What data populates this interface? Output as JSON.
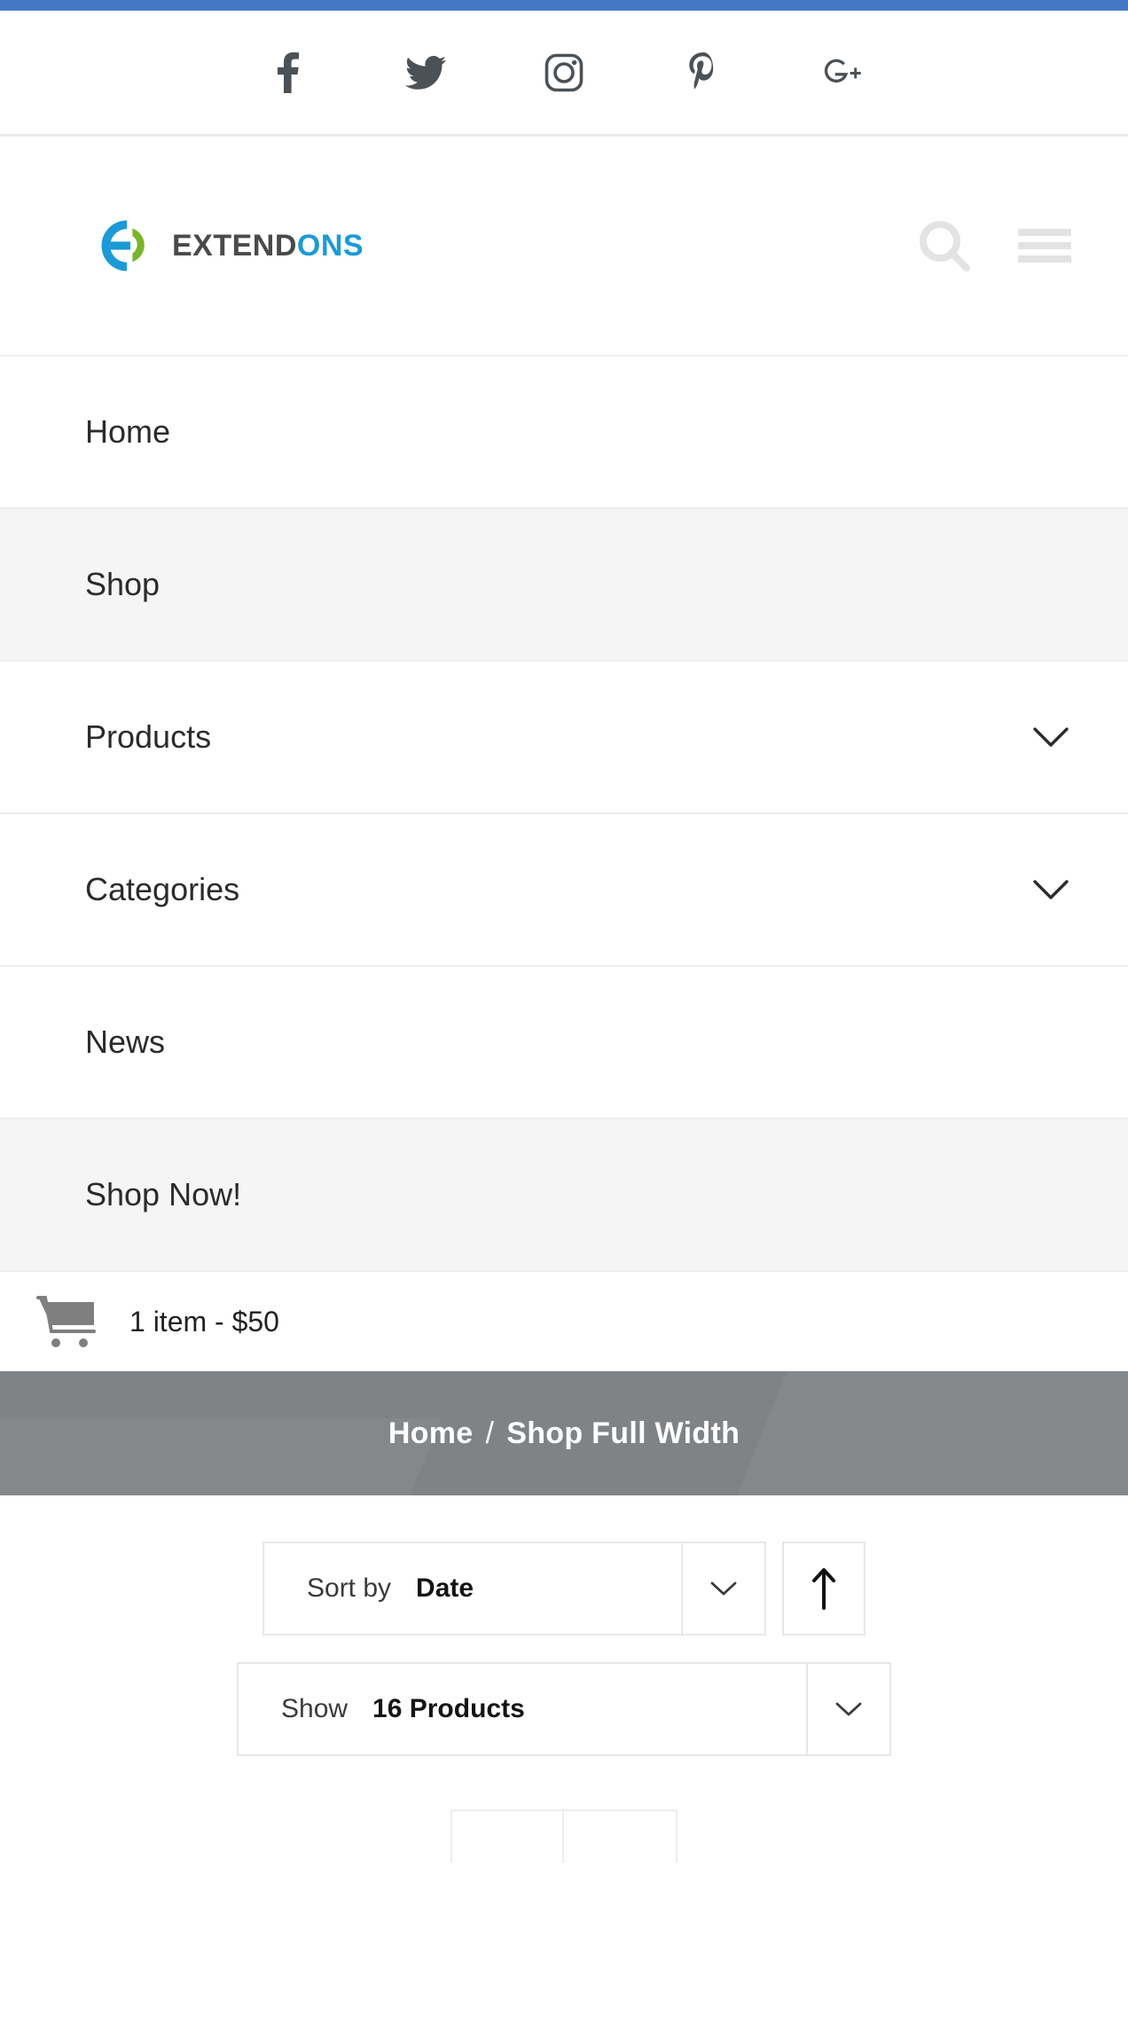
{
  "theme": {
    "accent_blue": "#4578c4",
    "brand_dark": "#4a4a4a",
    "brand_blue": "#1c9ad6",
    "brand_green": "#7ab52b",
    "banner_gray": "#808385",
    "row_active_gray": "#f5f5f5",
    "icon_gray": "#4c5156",
    "border_gray": "#e8e8e8"
  },
  "topbar": {
    "social": [
      {
        "name": "facebook-icon",
        "label": "Facebook"
      },
      {
        "name": "twitter-icon",
        "label": "Twitter"
      },
      {
        "name": "instagram-icon",
        "label": "Instagram"
      },
      {
        "name": "pinterest-icon",
        "label": "Pinterest"
      },
      {
        "name": "googleplus-icon",
        "label": "Google Plus"
      }
    ]
  },
  "header": {
    "logo": {
      "text_primary": "EXTEND",
      "text_secondary": "ONS",
      "alt": "Extendons"
    },
    "search_label": "Search",
    "menu_label": "Menu"
  },
  "nav": {
    "items": [
      {
        "label": "Home",
        "active": false,
        "has_chevron": false,
        "sub": false
      },
      {
        "label": "Shop",
        "active": true,
        "has_chevron": false,
        "sub": false
      },
      {
        "label": "Products",
        "active": false,
        "has_chevron": true,
        "sub": false
      },
      {
        "label": "Categories",
        "active": false,
        "has_chevron": true,
        "sub": false
      },
      {
        "label": "News",
        "active": false,
        "has_chevron": false,
        "sub": false
      },
      {
        "label": "Shop Now!",
        "active": true,
        "has_chevron": false,
        "sub": true
      }
    ]
  },
  "cart": {
    "summary": "1 item - $50",
    "item_count": 1,
    "total": "$50"
  },
  "banner": {
    "crumb_home": "Home",
    "separator": "/",
    "crumb_current": "Shop Full Width"
  },
  "toolbar": {
    "sort": {
      "caption": "Sort by",
      "value": "Date",
      "direction": "ascending",
      "direction_icon": "arrow-up-icon"
    },
    "show": {
      "caption": "Show",
      "value": "16 Products"
    }
  }
}
